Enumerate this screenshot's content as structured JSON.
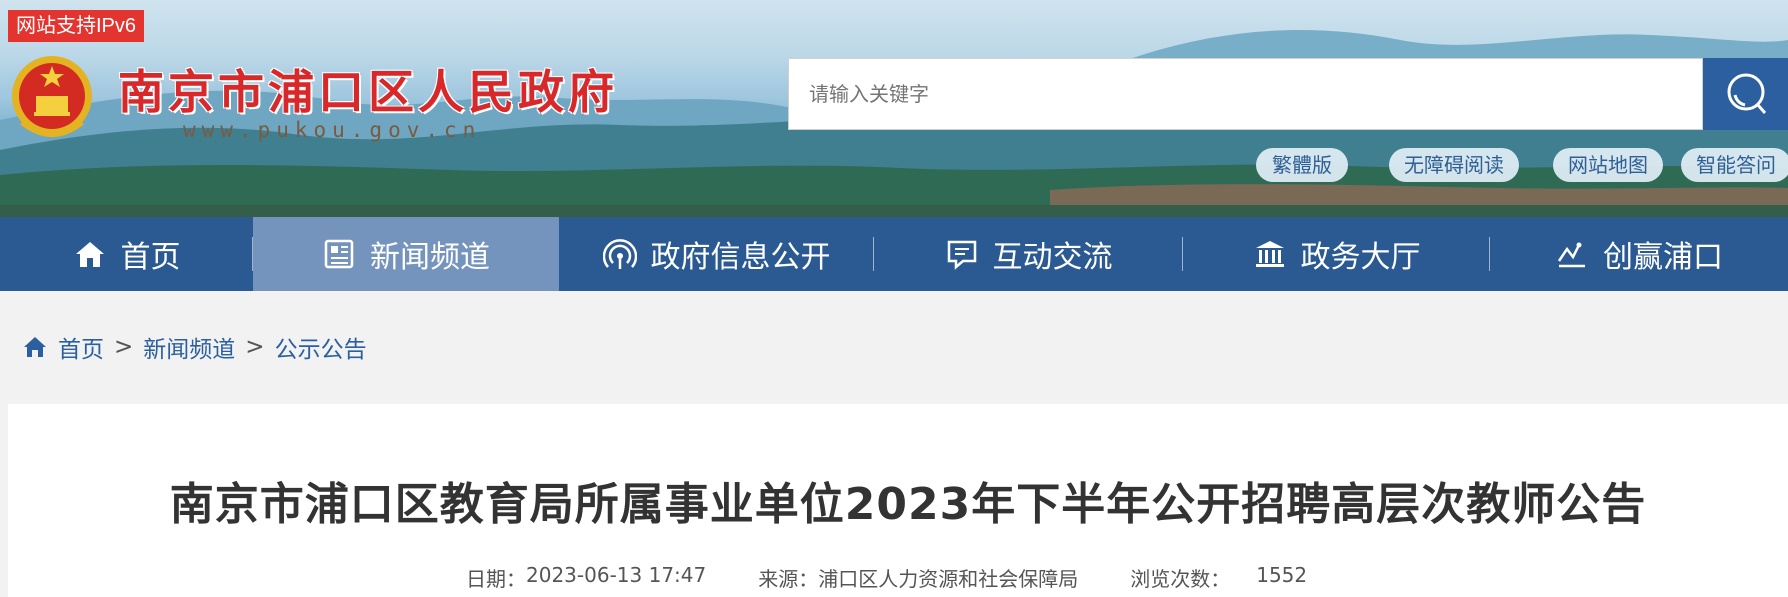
{
  "header": {
    "ipv6_badge": "网站支持IPv6",
    "site_title": "南京市浦口区人民政府",
    "site_url": "www.pukou.gov.cn",
    "search_placeholder": "请输入关键字",
    "quick_links": [
      {
        "label": "繁體版"
      },
      {
        "label": "无障碍阅读"
      },
      {
        "label": "网站地图"
      },
      {
        "label": "智能答问"
      }
    ]
  },
  "nav": {
    "items": [
      {
        "label": "首页",
        "icon": "home-icon",
        "active": false
      },
      {
        "label": "新闻频道",
        "icon": "newspaper-icon",
        "active": true
      },
      {
        "label": "政府信息公开",
        "icon": "broadcast-icon",
        "active": false
      },
      {
        "label": "互动交流",
        "icon": "chat-icon",
        "active": false
      },
      {
        "label": "政务大厅",
        "icon": "building-icon",
        "active": false
      },
      {
        "label": "创赢浦口",
        "icon": "trend-icon",
        "active": false
      }
    ]
  },
  "breadcrumb": {
    "items": [
      "首页",
      "新闻频道",
      "公示公告"
    ],
    "separator": ">"
  },
  "article": {
    "title": "南京市浦口区教育局所属事业单位2023年下半年公开招聘高层次教师公告",
    "date_label": "日期：",
    "date": "2023-06-13 17:47",
    "source_label": "来源：",
    "source": "浦口区人力资源和社会保障局",
    "views_label": "浏览次数：",
    "views": "1552"
  },
  "colors": {
    "nav_bg": "#2b5a93",
    "nav_active": "#7594bd",
    "title_red": "#d8282a",
    "link_blue": "#2b5fa0"
  }
}
